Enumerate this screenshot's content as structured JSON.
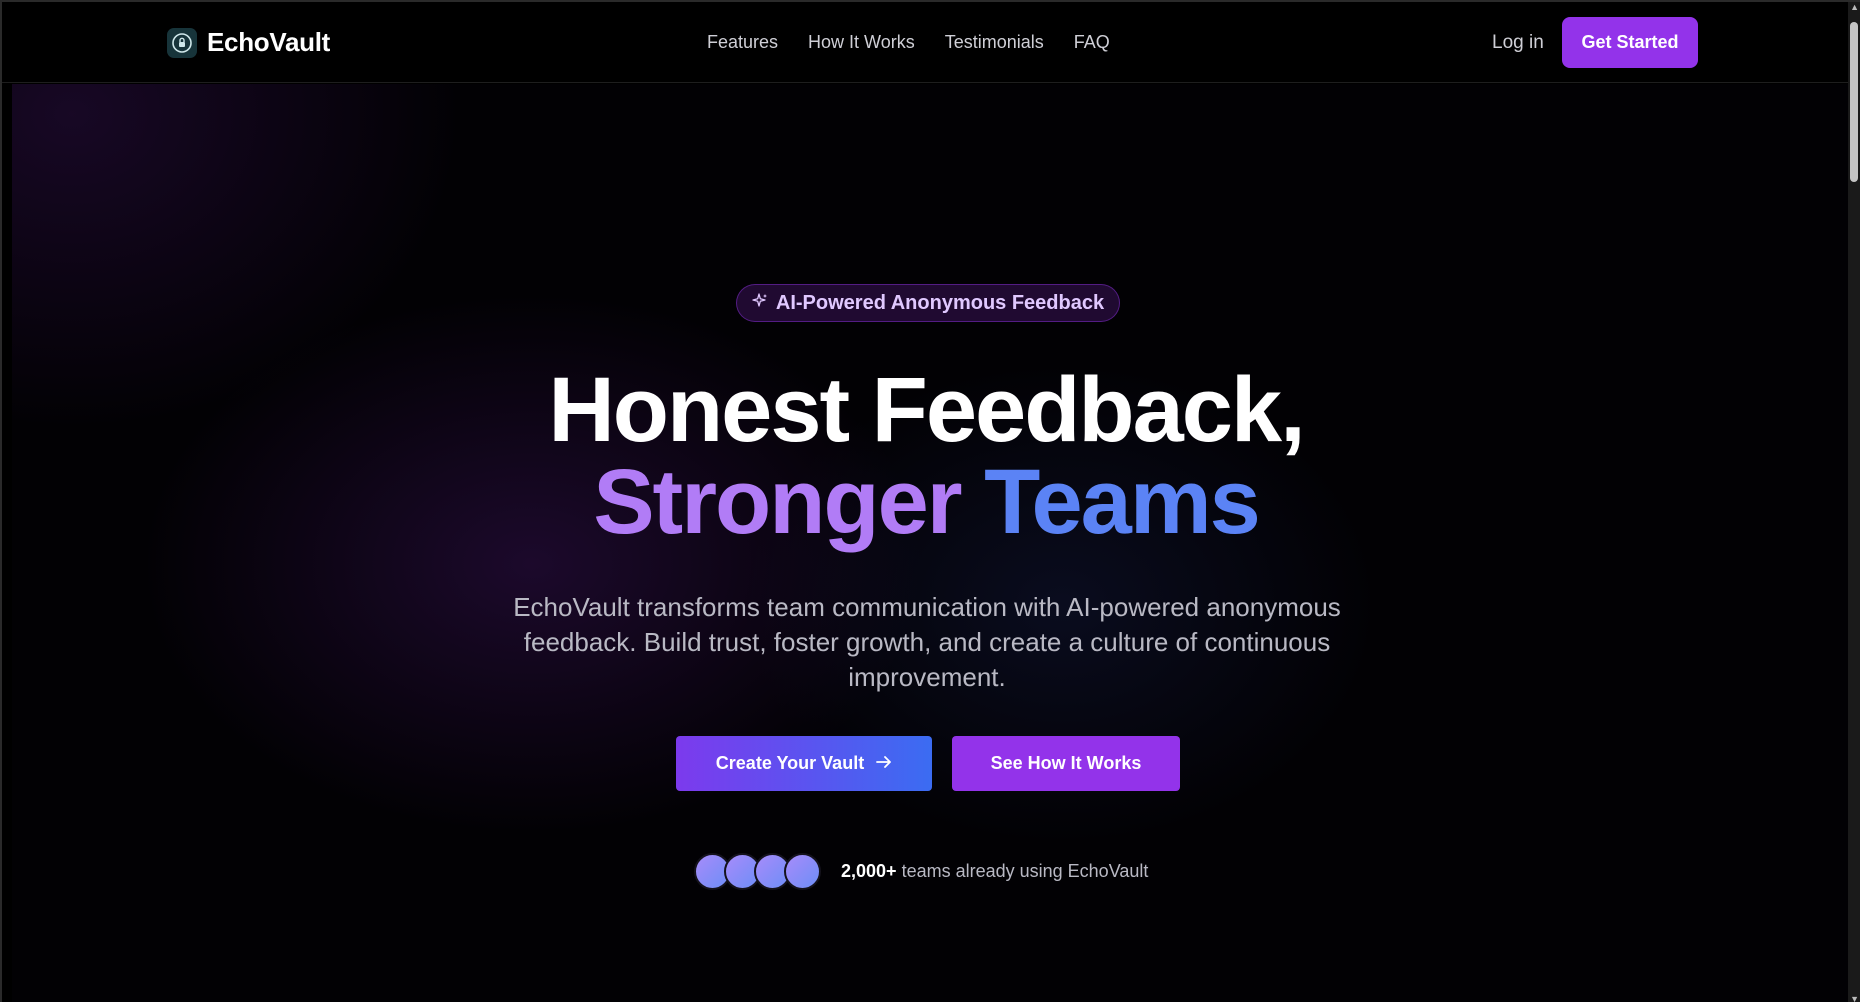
{
  "nav": {
    "brand": "EchoVault",
    "links": [
      "Features",
      "How It Works",
      "Testimonials",
      "FAQ"
    ],
    "login": "Log in",
    "cta": "Get Started",
    "logo_icon": "lock-shield-icon"
  },
  "hero": {
    "badge_icon": "sparkles-icon",
    "badge": "AI-Powered Anonymous Feedback",
    "headline_line1": "Honest Feedback,",
    "headline_word_a": "Stronger",
    "headline_word_b": "Teams",
    "subtext": "EchoVault transforms team communication with AI-powered anonymous feedback. Build trust, foster growth, and create a culture of continuous improvement.",
    "primary_cta": "Create Your Vault",
    "primary_cta_icon": "arrow-right-icon",
    "secondary_cta": "See How It Works",
    "social_count": "2,000+",
    "social_text": "teams already using EchoVault"
  },
  "colors": {
    "accent_purple": "#9333ea",
    "gradient_purple": "#b17cf6",
    "gradient_blue": "#5b83f5",
    "background": "#000000"
  }
}
